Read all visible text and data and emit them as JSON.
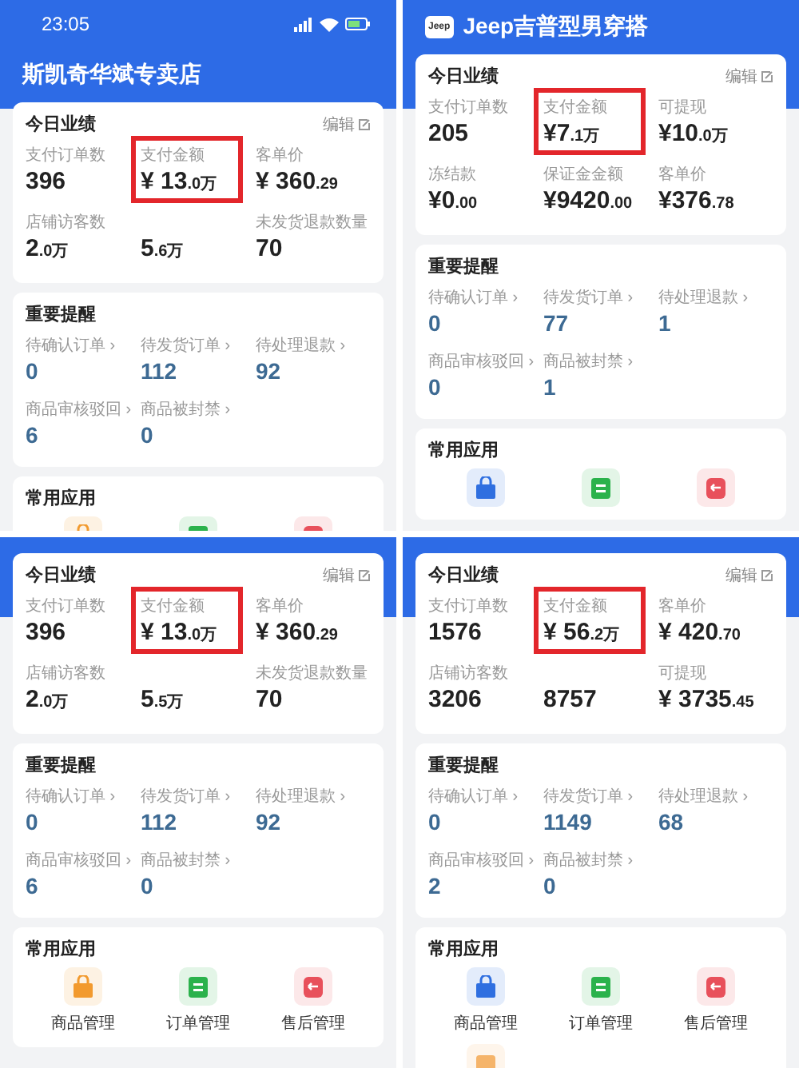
{
  "screenshots": [
    {
      "status_bar": {
        "time": "23:05"
      },
      "header": {
        "title": "斯凯奇华斌专卖店"
      },
      "performance": {
        "title": "今日业绩",
        "edit": "编辑",
        "metrics": [
          {
            "label": "支付订单数",
            "value": "396",
            "highlighted": false
          },
          {
            "label": "支付金额",
            "value": "¥ 13",
            "unit": ".0万",
            "highlighted": true
          },
          {
            "label": "客单价",
            "value": "¥ 360",
            "unit": ".29",
            "highlighted": false
          },
          {
            "label": "店铺访客数",
            "value": "2",
            "unit": ".0万",
            "highlighted": false
          },
          {
            "value": "5",
            "unit": ".6万",
            "highlighted": false
          },
          {
            "label": "未发货退款数量",
            "value": "70",
            "highlighted": false
          }
        ]
      },
      "reminders": {
        "title": "重要提醒",
        "items": [
          {
            "label": "待确认订单 ›",
            "count": "0"
          },
          {
            "label": "待发货订单 ›",
            "count": "112"
          },
          {
            "label": "待处理退款 ›",
            "count": "92"
          },
          {
            "label": "商品审核驳回 ›",
            "count": "6"
          },
          {
            "label": "商品被封禁 ›",
            "count": "0"
          }
        ]
      },
      "apps": {
        "title": "常用应用",
        "items": [
          {
            "kind": "bag",
            "color": "#f29a2e"
          },
          {
            "kind": "list",
            "color": "#2bb24c"
          },
          {
            "kind": "return",
            "color": "#e8505b"
          }
        ]
      }
    },
    {
      "header": {
        "title": "Jeep吉普型男穿搭",
        "logo_text": "Jeep"
      },
      "performance": {
        "title": "今日业绩",
        "edit": "编辑",
        "metrics": [
          {
            "label": "支付订单数",
            "value": "205",
            "highlighted": false
          },
          {
            "label": "支付金额",
            "value": "¥7",
            "unit": ".1万",
            "highlighted": true
          },
          {
            "label": "可提现",
            "value": "¥10",
            "unit": ".0万",
            "highlighted": false
          },
          {
            "label": "冻结款",
            "value": "¥0",
            "unit": ".00",
            "highlighted": false
          },
          {
            "label": "保证金金额",
            "value": "¥9420",
            "unit": ".00",
            "highlighted": false
          },
          {
            "label": "客单价",
            "value": "¥376",
            "unit": ".78",
            "highlighted": false
          }
        ]
      },
      "reminders": {
        "title": "重要提醒",
        "items": [
          {
            "label": "待确认订单 ›",
            "count": "0"
          },
          {
            "label": "待发货订单 ›",
            "count": "77"
          },
          {
            "label": "待处理退款 ›",
            "count": "1"
          },
          {
            "label": "商品审核驳回 ›",
            "count": "0"
          },
          {
            "label": "商品被封禁 ›",
            "count": "1"
          }
        ]
      },
      "apps": {
        "title": "常用应用",
        "items": [
          {
            "kind": "bag",
            "color": "#2f6fe0"
          },
          {
            "kind": "list",
            "color": "#2bb24c"
          },
          {
            "kind": "return",
            "color": "#e8505b"
          }
        ]
      }
    },
    {
      "performance": {
        "title": "今日业绩",
        "edit": "编辑",
        "metrics": [
          {
            "label": "支付订单数",
            "value": "396",
            "highlighted": false
          },
          {
            "label": "支付金额",
            "value": "¥ 13",
            "unit": ".0万",
            "highlighted": true
          },
          {
            "label": "客单价",
            "value": "¥ 360",
            "unit": ".29",
            "highlighted": false
          },
          {
            "label": "店铺访客数",
            "value": "2",
            "unit": ".0万",
            "highlighted": false
          },
          {
            "value": "5",
            "unit": ".5万",
            "highlighted": false
          },
          {
            "label": "未发货退款数量",
            "value": "70",
            "highlighted": false
          }
        ]
      },
      "reminders": {
        "title": "重要提醒",
        "items": [
          {
            "label": "待确认订单 ›",
            "count": "0"
          },
          {
            "label": "待发货订单 ›",
            "count": "112"
          },
          {
            "label": "待处理退款 ›",
            "count": "92"
          },
          {
            "label": "商品审核驳回 ›",
            "count": "6"
          },
          {
            "label": "商品被封禁 ›",
            "count": "0"
          }
        ]
      },
      "apps": {
        "title": "常用应用",
        "items": [
          {
            "kind": "bag",
            "color": "#f29a2e",
            "label": "商品管理"
          },
          {
            "kind": "list",
            "color": "#2bb24c",
            "label": "订单管理"
          },
          {
            "kind": "return",
            "color": "#e8505b",
            "label": "售后管理"
          }
        ]
      }
    },
    {
      "performance": {
        "title": "今日业绩",
        "edit": "编辑",
        "metrics": [
          {
            "label": "支付订单数",
            "value": "1576",
            "highlighted": false
          },
          {
            "label": "支付金额",
            "value": "¥ 56",
            "unit": ".2万",
            "highlighted": true
          },
          {
            "label": "客单价",
            "value": "¥ 420",
            "unit": ".70",
            "highlighted": false
          },
          {
            "label": "店铺访客数",
            "value": "3206",
            "highlighted": false
          },
          {
            "value": "8757",
            "highlighted": false
          },
          {
            "label": "可提现",
            "value": "¥ 3735",
            "unit": ".45",
            "highlighted": false
          }
        ]
      },
      "reminders": {
        "title": "重要提醒",
        "items": [
          {
            "label": "待确认订单 ›",
            "count": "0"
          },
          {
            "label": "待发货订单 ›",
            "count": "1149"
          },
          {
            "label": "待处理退款 ›",
            "count": "68"
          },
          {
            "label": "商品审核驳回 ›",
            "count": "2"
          },
          {
            "label": "商品被封禁 ›",
            "count": "0"
          }
        ]
      },
      "apps": {
        "title": "常用应用",
        "items": [
          {
            "kind": "bag",
            "color": "#2f6fe0",
            "label": "商品管理"
          },
          {
            "kind": "list",
            "color": "#2bb24c",
            "label": "订单管理"
          },
          {
            "kind": "return",
            "color": "#e8505b",
            "label": "售后管理"
          },
          {
            "kind": "card",
            "color": "#f5b46a"
          }
        ]
      }
    }
  ]
}
